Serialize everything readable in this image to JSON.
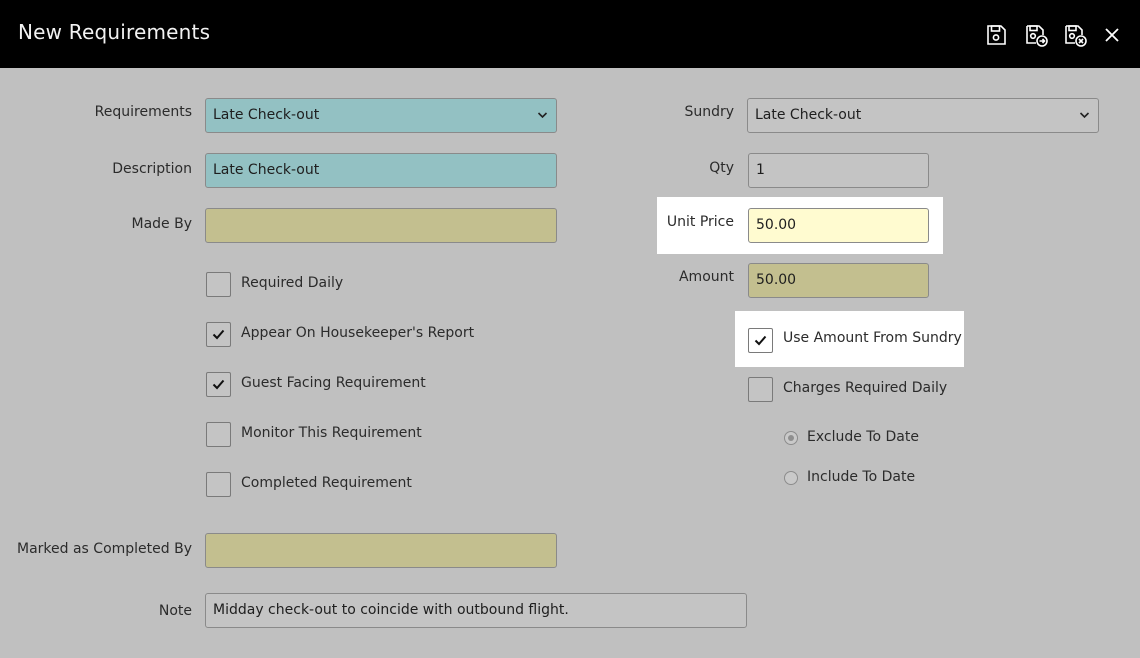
{
  "window": {
    "title": "New Requirements"
  },
  "toolbar": {
    "icons": [
      "save-icon",
      "save-and-continue-icon",
      "save-and-close-icon",
      "close-icon"
    ]
  },
  "form": {
    "requirements": {
      "label": "Requirements",
      "value": "Late Check-out"
    },
    "description": {
      "label": "Description",
      "value": "Late Check-out"
    },
    "made_by": {
      "label": "Made By",
      "value": ""
    },
    "checkboxes": {
      "required_daily": {
        "label": "Required Daily",
        "checked": false
      },
      "appear_on_report": {
        "label": "Appear On Housekeeper's Report",
        "checked": true
      },
      "guest_facing": {
        "label": "Guest Facing Requirement",
        "checked": true
      },
      "monitor": {
        "label": "Monitor This Requirement",
        "checked": false
      },
      "completed": {
        "label": "Completed Requirement",
        "checked": false
      }
    },
    "marked_completed_by": {
      "label": "Marked as Completed By",
      "value": ""
    },
    "note": {
      "label": "Note",
      "value": "Midday check-out to coincide with outbound flight."
    },
    "sundry": {
      "label": "Sundry",
      "value": "Late Check-out"
    },
    "qty": {
      "label": "Qty",
      "value": "1"
    },
    "unit_price": {
      "label": "Unit Price",
      "value": "50.00"
    },
    "amount": {
      "label": "Amount",
      "value": "50.00"
    },
    "use_amount_from_sundry": {
      "label": "Use Amount From Sundry",
      "checked": true
    },
    "charges_required_daily": {
      "label": "Charges Required Daily",
      "checked": false
    },
    "radios": {
      "exclude_to_date": {
        "label": "Exclude To Date",
        "selected": true
      },
      "include_to_date": {
        "label": "Include To Date",
        "selected": false
      }
    }
  },
  "colors": {
    "background": "#c0c0c0",
    "titlebar": "#000000",
    "teal_field": "#93c1c3",
    "khaki_field": "#c3bf8f",
    "highlight_field": "#fffbd0"
  }
}
